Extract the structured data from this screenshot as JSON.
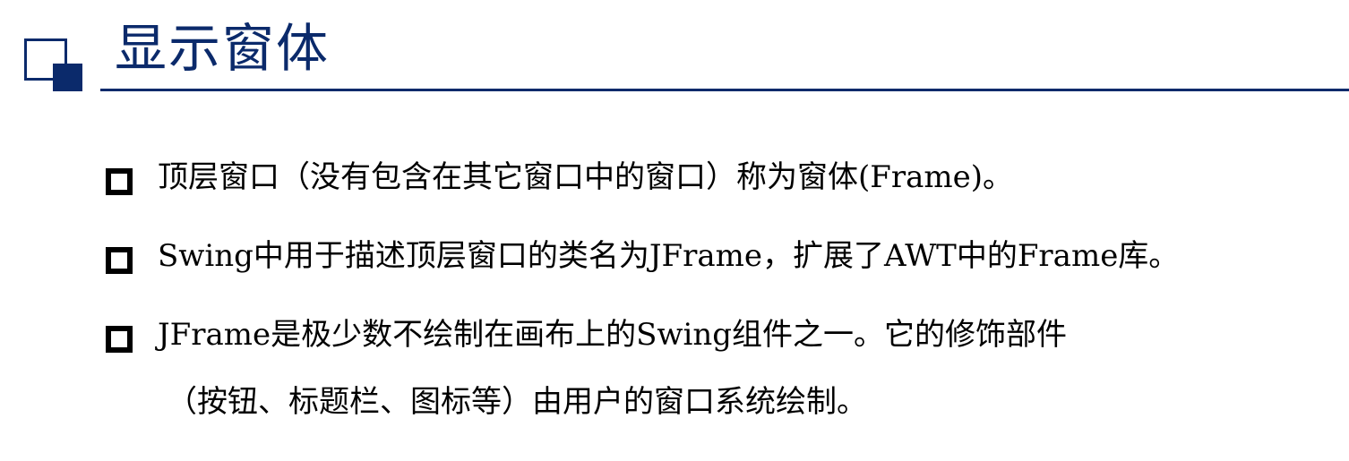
{
  "header": {
    "title": "显示窗体"
  },
  "bullets": [
    {
      "text": "顶层窗口（没有包含在其它窗口中的窗口）称为窗体(Frame)。"
    },
    {
      "text": "Swing中用于描述顶层窗口的类名为JFrame，扩展了AWT中的Frame库。"
    },
    {
      "line1": "JFrame是极少数不绘制在画布上的Swing组件之一。它的修饰部件",
      "line2": "（按钮、标题栏、图标等）由用户的窗口系统绘制。"
    }
  ],
  "colors": {
    "accent": "#0b2a6b",
    "text": "#000000",
    "background": "#ffffff"
  }
}
